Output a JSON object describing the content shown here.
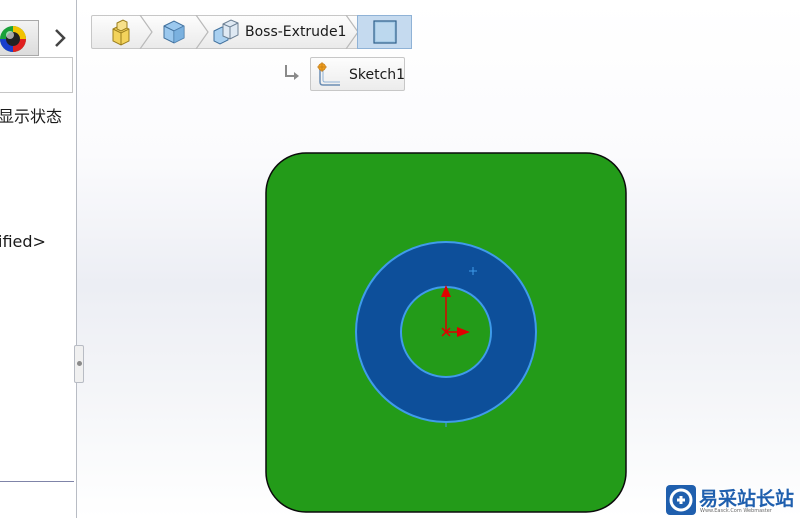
{
  "left_panel": {
    "text_display_states": "显示状态",
    "text_unspecified": "ified>"
  },
  "breadcrumb": {
    "items": [
      {
        "icon": "part-icon"
      },
      {
        "icon": "body-icon"
      },
      {
        "icon": "boss-extrude-icon",
        "label": "Boss-Extrude1"
      },
      {
        "icon": "face-icon",
        "active": true
      }
    ],
    "sub_item": {
      "icon": "sketch-icon",
      "label": "Sketch1"
    }
  },
  "model": {
    "plate_color": "#239b19",
    "ring_color": "#0d4f9a",
    "ring_edge_color": "#3f9bea",
    "origin_color": "#e00000"
  },
  "watermark": {
    "text": "易采站长站",
    "subtext": "Www.Easck.Com  Webmaster"
  }
}
